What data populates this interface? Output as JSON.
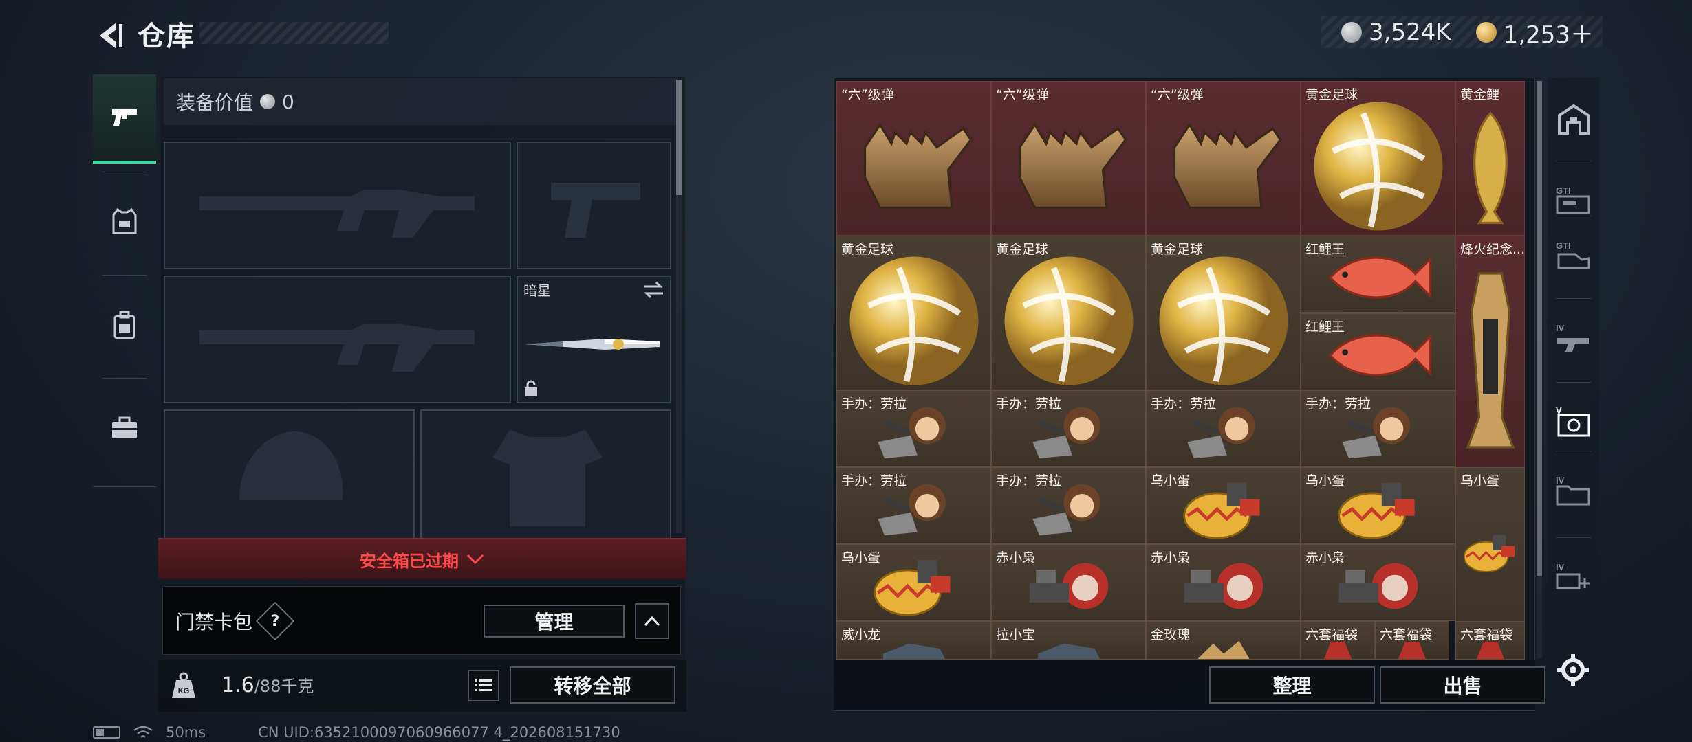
{
  "header": {
    "title": "仓库",
    "silver_amount": "3,524K",
    "gold_amount": "1,253＋"
  },
  "side_nav": [
    {
      "name": "weapons",
      "icon": "pistol-icon",
      "active": true
    },
    {
      "name": "armor",
      "icon": "vest-icon",
      "active": false
    },
    {
      "name": "backpack",
      "icon": "backpack-icon",
      "active": false
    },
    {
      "name": "medkit",
      "icon": "briefcase-icon",
      "active": false
    }
  ],
  "equipment": {
    "value_label": "装备价值",
    "value_amount": "0",
    "melee_name": "暗星"
  },
  "safebox": {
    "expired_text": "安全箱已过期"
  },
  "keycard": {
    "label": "门禁卡包",
    "help": "?",
    "manage_label": "管理"
  },
  "capacity": {
    "current": "1.6",
    "max": "/88千克",
    "transfer_all_label": "转移全部"
  },
  "status": {
    "ping": "50ms",
    "uid": "CN UID:6352100097060966077 4_202608151730"
  },
  "grid": {
    "items": [
      {
        "label": "“六”级弹",
        "art": "hand",
        "bg": "red"
      },
      {
        "label": "“六”级弹",
        "art": "hand",
        "bg": "red"
      },
      {
        "label": "“六”级弹",
        "art": "hand",
        "bg": "red"
      },
      {
        "label": "黄金足球",
        "art": "ball",
        "bg": "red"
      },
      {
        "label": "黄金鲤",
        "art": "goldfish",
        "bg": "red"
      },
      {
        "label": "黄金足球",
        "art": "ball",
        "bg": "brown"
      },
      {
        "label": "黄金足球",
        "art": "ball",
        "bg": "brown"
      },
      {
        "label": "黄金足球",
        "art": "ball",
        "bg": "brown"
      },
      {
        "label": "红鲤王",
        "art": "redfish",
        "bg": "brown"
      },
      {
        "label": "红鲤王",
        "art": "redfish",
        "bg": "brown"
      },
      {
        "label": "烽火纪念...",
        "art": "trophy",
        "bg": "red"
      },
      {
        "label": "手办：劳拉",
        "art": "figure",
        "bg": "brown"
      },
      {
        "label": "手办：劳拉",
        "art": "figure",
        "bg": "brown"
      },
      {
        "label": "手办：劳拉",
        "art": "figure",
        "bg": "brown"
      },
      {
        "label": "手办：劳拉",
        "art": "figure",
        "bg": "brown"
      },
      {
        "label": "手办：劳拉",
        "art": "figure",
        "bg": "brown"
      },
      {
        "label": "手办：劳拉",
        "art": "figure",
        "bg": "brown"
      },
      {
        "label": "乌小蛋",
        "art": "egg",
        "bg": "brown"
      },
      {
        "label": "乌小蛋",
        "art": "egg",
        "bg": "brown"
      },
      {
        "label": "乌小蛋",
        "art": "egg",
        "bg": "brown"
      },
      {
        "label": "乌小蛋",
        "art": "egg",
        "bg": "brown"
      },
      {
        "label": "赤小枭",
        "art": "owl",
        "bg": "brown"
      },
      {
        "label": "赤小枭",
        "art": "owl",
        "bg": "brown"
      },
      {
        "label": "赤小枭",
        "art": "owl",
        "bg": "brown"
      },
      {
        "label": "威小龙",
        "art": "dragon",
        "bg": "brown"
      },
      {
        "label": "拉小宝",
        "art": "dragon",
        "bg": "brown"
      },
      {
        "label": "金玫瑰",
        "art": "rose",
        "bg": "brown"
      },
      {
        "label": "六套福袋",
        "art": "bag",
        "bg": "brown"
      },
      {
        "label": "六套福袋",
        "art": "bag",
        "bg": "brown"
      },
      {
        "label": "六套福袋",
        "art": "bag",
        "bg": "brown"
      }
    ],
    "sort_label": "整理",
    "sell_label": "出售"
  },
  "right_tabs": [
    "home-icon",
    "gti-box-icon",
    "gti-hand-icon",
    "iv-gun-icon",
    "vault-icon",
    "iv-folder-icon",
    "iv-plus-icon"
  ],
  "colors": {
    "accent": "#3fd6a6",
    "danger": "#ff4a4a",
    "cell_red": "#5a2c31",
    "cell_brown": "#4a3f32"
  }
}
